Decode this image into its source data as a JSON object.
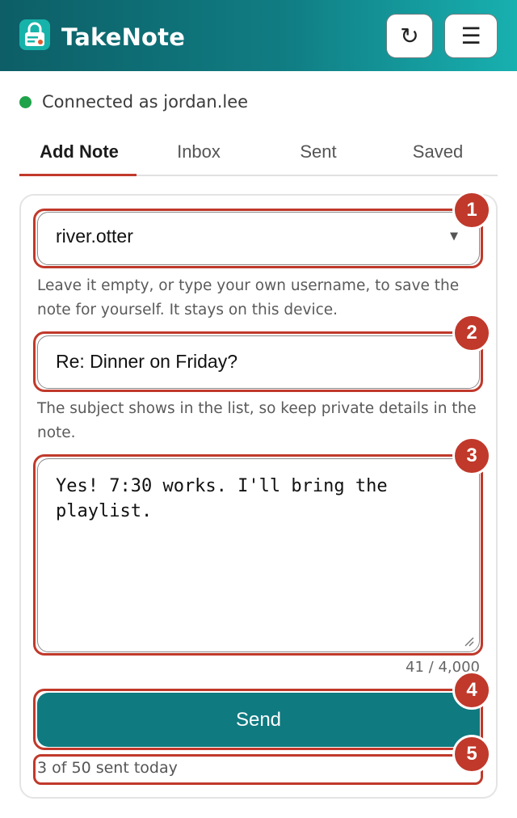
{
  "app": {
    "title": "TakeNote",
    "logo_icon": "lock-note-icon"
  },
  "header": {
    "refresh": {
      "icon": "refresh-icon",
      "glyph": "↻"
    },
    "menu": {
      "icon": "hamburger-menu-icon",
      "glyph": "☰"
    }
  },
  "status": {
    "text": "Connected as jordan.lee",
    "color": "#1fa34a"
  },
  "tabs": [
    {
      "label": "Add Note",
      "active": true
    },
    {
      "label": "Inbox",
      "active": false
    },
    {
      "label": "Sent",
      "active": false
    },
    {
      "label": "Saved",
      "active": false
    }
  ],
  "form": {
    "recipient": {
      "value": "river.otter",
      "hint": "Leave it empty, or type your own username, to save the note for yourself. It stays on this device."
    },
    "subject": {
      "value": "Re: Dinner on Friday?",
      "hint": "The subject shows in the list, so keep private details in the note."
    },
    "body": {
      "value": "Yes! 7:30 works. I'll bring the\nplaylist.",
      "char_count": "41 / 4,000"
    },
    "send_label": "Send",
    "sent_today": "3 of 50 sent today"
  },
  "annotations": [
    "1",
    "2",
    "3",
    "4",
    "5"
  ],
  "colors": {
    "accent": "#0f7a80",
    "highlight": "#c0392b"
  }
}
